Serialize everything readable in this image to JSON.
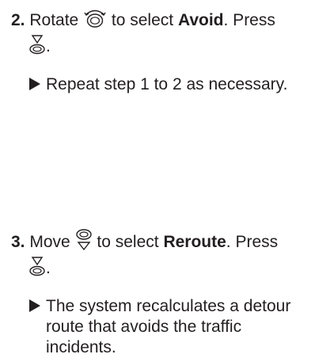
{
  "step2": {
    "number": "2.",
    "text_a": " Rotate ",
    "text_b": " to select ",
    "bold_target": "Avoid",
    "text_c": ". Press",
    "text_after_icon": ".",
    "result": "Repeat step 1 to 2 as necessary."
  },
  "step3": {
    "number": "3.",
    "text_a": " Move ",
    "text_b": " to select ",
    "bold_target": "Reroute",
    "text_c": ". Press",
    "text_after_icon": ".",
    "result": "The system recalculates a detour route that avoids the traffic incidents."
  },
  "icons": {
    "rotate": "interface-dial-rotate-icon",
    "move": "interface-dial-move-down-icon",
    "press": "interface-dial-press-icon",
    "arrow": "result-arrow-icon"
  },
  "colors": {
    "text": "#231f20"
  }
}
